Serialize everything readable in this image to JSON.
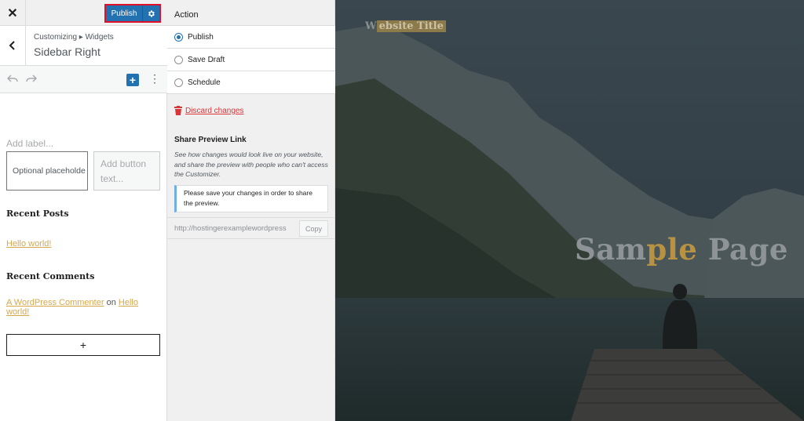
{
  "header": {
    "close_icon": "close-icon",
    "publish_label": "Publish",
    "settings_icon": "gear-icon"
  },
  "breadcrumb": {
    "path": "Customizing ▸ Widgets",
    "title": "Sidebar Right"
  },
  "editor_toolbar": {
    "undo_icon": "undo-icon",
    "redo_icon": "redo-icon",
    "add_block_icon": "plus-icon",
    "options_icon": "more-vertical-icon"
  },
  "widgets": {
    "search": {
      "label_placeholder": "Add label...",
      "input_placeholder": "Optional placeholde",
      "button_placeholder": "Add button text..."
    },
    "recent_posts": {
      "title": "Recent Posts",
      "link": "Hello world!"
    },
    "recent_comments": {
      "title": "Recent Comments",
      "author": "A WordPress Commenter",
      "on": "on",
      "post": "Hello world!"
    },
    "appender_label": "+"
  },
  "publish_panel": {
    "heading": "Action",
    "options": [
      "Publish",
      "Save Draft",
      "Schedule"
    ],
    "selected": "Publish",
    "discard_label": "Discard changes",
    "share_heading": "Share Preview Link",
    "share_description": "See how changes would look live on your website, and share the preview with people who can't access the Customizer.",
    "notice": "Please save your changes in order to share the preview.",
    "preview_url": "http://hostingerexamplewordpress",
    "copy_label": "Copy"
  },
  "preview": {
    "site_title_a": "W",
    "site_title_b": "ebsite Title",
    "page_title_a": "Sam",
    "page_title_b": "ple",
    "page_title_c": " Page"
  },
  "colors": {
    "accent": "#2271b1",
    "highlight_border": "#e0102a",
    "link": "#d7a84c",
    "danger": "#d63638"
  }
}
